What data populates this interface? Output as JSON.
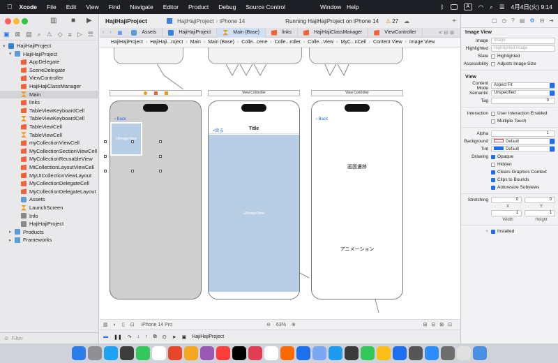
{
  "menubar": {
    "app": "Xcode",
    "items": [
      "File",
      "Edit",
      "View",
      "Find",
      "Navigate",
      "Editor",
      "Product",
      "Debug",
      "Source Control"
    ],
    "window_item": "Window",
    "help_item": "Help",
    "input_method": "A",
    "datetime": "4月4日(火) 9:14"
  },
  "sidebar": {
    "filter_placeholder": "Filter",
    "tree": [
      {
        "label": "HajiHajiProject",
        "icon": "proj",
        "indent": 0,
        "disc": "▾"
      },
      {
        "label": "HajiHajiProject",
        "icon": "folder",
        "indent": 1,
        "disc": "▾"
      },
      {
        "label": "AppDelegate",
        "icon": "swift",
        "indent": 2
      },
      {
        "label": "SceneDelegate",
        "icon": "swift",
        "indent": 2
      },
      {
        "label": "ViewController",
        "icon": "swift",
        "indent": 2
      },
      {
        "label": "HajiHajiClassManager",
        "icon": "swift",
        "indent": 2
      },
      {
        "label": "Main",
        "icon": "xib",
        "indent": 2,
        "selected": true
      },
      {
        "label": "links",
        "icon": "swift",
        "indent": 2
      },
      {
        "label": "TableViewKeyboardCell",
        "icon": "swift",
        "indent": 2
      },
      {
        "label": "TableViewKeyboardCell",
        "icon": "xib",
        "indent": 2
      },
      {
        "label": "TableViewCell",
        "icon": "swift",
        "indent": 2
      },
      {
        "label": "TableViewCell",
        "icon": "xib",
        "indent": 2
      },
      {
        "label": "myCollectionViewCell",
        "icon": "swift",
        "indent": 2
      },
      {
        "label": "MyCollectionSectionViewCell",
        "icon": "swift",
        "indent": 2
      },
      {
        "label": "MyCollectionReusableView",
        "icon": "swift",
        "indent": 2
      },
      {
        "label": "MtCollectionLayoutViewCell",
        "icon": "swift",
        "indent": 2
      },
      {
        "label": "MyUICollectionViewLayout",
        "icon": "swift",
        "indent": 2
      },
      {
        "label": "MyCollectionDelegateCell",
        "icon": "swift",
        "indent": 2
      },
      {
        "label": "MyCollectionDelegateLayout",
        "icon": "swift",
        "indent": 2
      },
      {
        "label": "Assets",
        "icon": "asset",
        "indent": 2
      },
      {
        "label": "LaunchScreen",
        "icon": "xib",
        "indent": 2
      },
      {
        "label": "Info",
        "icon": "plist",
        "indent": 2
      },
      {
        "label": "HajiHajiProject",
        "icon": "plist",
        "indent": 2
      },
      {
        "label": "Products",
        "icon": "folder",
        "indent": 1,
        "disc": "▸"
      },
      {
        "label": "Frameworks",
        "icon": "folder",
        "indent": 1,
        "disc": "▸"
      }
    ]
  },
  "toolbar": {
    "project": "HajiHajiProject",
    "scheme": "HajiHajiProject",
    "device": "iPhone 14",
    "status": "Running HajiHajiProject on iPhone 14",
    "warnings": "27"
  },
  "tabs": [
    {
      "label": "Assets",
      "active": false
    },
    {
      "label": "HajiHajiProject",
      "active": false
    },
    {
      "label": "Main (Base)",
      "active": true
    },
    {
      "label": "links",
      "active": false
    },
    {
      "label": "HajiHajiClassManager",
      "active": false
    },
    {
      "label": "ViewController",
      "active": false
    }
  ],
  "jumpbar": [
    "HajiHajiProject",
    "HajiHaji...roject",
    "Main",
    "Main (Base)",
    "Colle...cene",
    "Colle...roller",
    "Colle...View",
    "MyC...nCell",
    "Content View",
    "Image View"
  ],
  "canvas": {
    "scene_bar_label": "View Controller",
    "back_label": "Back",
    "back_label_jp": "<戻る",
    "title_label": "Title",
    "image_view_label": "UIImageView",
    "image_view_small_label": "UIImageView",
    "transition_label": "画面遷移",
    "animation_label": "アニメーション"
  },
  "editorbar": {
    "device": "iPhone 14 Pro",
    "zoom": "63%"
  },
  "debugbar": {
    "target": "HajiHajiProject"
  },
  "inspector": {
    "section1": "Image View",
    "image_label": "Image",
    "image_placeholder": "Image",
    "highlighted_label": "Highlighted",
    "highlighted_placeholder": "Highlighted Image",
    "state_label": "State",
    "state_value": "Highlighted",
    "accessibility_label": "Accessibility",
    "accessibility_value": "Adjusts Image Size",
    "section2": "View",
    "content_mode_label": "Content Mode",
    "content_mode_value": "Aspect Fit",
    "semantic_label": "Semantic",
    "semantic_value": "Unspecified",
    "tag_label": "Tag",
    "tag_value": "0",
    "interaction_label": "Interaction",
    "uie_value": "User Interaction Enabled",
    "multitouch_value": "Multiple Touch",
    "alpha_label": "Alpha",
    "alpha_value": "1",
    "background_label": "Background",
    "background_value": "Default",
    "tint_label": "Tint",
    "tint_value": "Default",
    "drawing_label": "Drawing",
    "opaque_value": "Opaque",
    "hidden_value": "Hidden",
    "clears_value": "Clears Graphics Context",
    "clips_value": "Clips to Bounds",
    "autoresize_value": "Autoresize Subviews",
    "stretching_label": "Stretching",
    "stretch_x": "0",
    "stretch_y": "0",
    "x_caption": "X",
    "y_caption": "Y",
    "stretch_w": "1",
    "stretch_h": "1",
    "width_caption": "Width",
    "height_caption": "Height",
    "installed_value": "Installed"
  },
  "colors": {
    "accent": "#1d6ff0",
    "menubar": "#1d1f24",
    "imageview": "#b7cde4"
  }
}
